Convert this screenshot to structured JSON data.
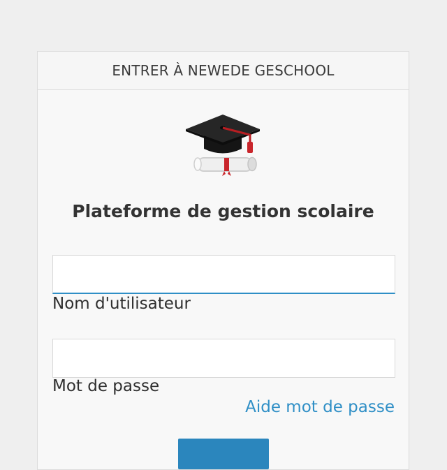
{
  "header": {
    "title": "ENTRER À NEWEDE GESCHOOL"
  },
  "logo": {
    "icon": "graduation-cap-diploma-icon"
  },
  "platform": {
    "title": "Plateforme de gestion scolaire"
  },
  "form": {
    "username": {
      "value": "",
      "label": "Nom d'utilisateur"
    },
    "password": {
      "value": "",
      "label": "Mot de passe"
    },
    "help_link": "Aide mot de passe",
    "submit": {
      "label": ""
    }
  },
  "colors": {
    "accent": "#2f8fc6",
    "button": "#2b86bd",
    "background": "#efefef"
  }
}
